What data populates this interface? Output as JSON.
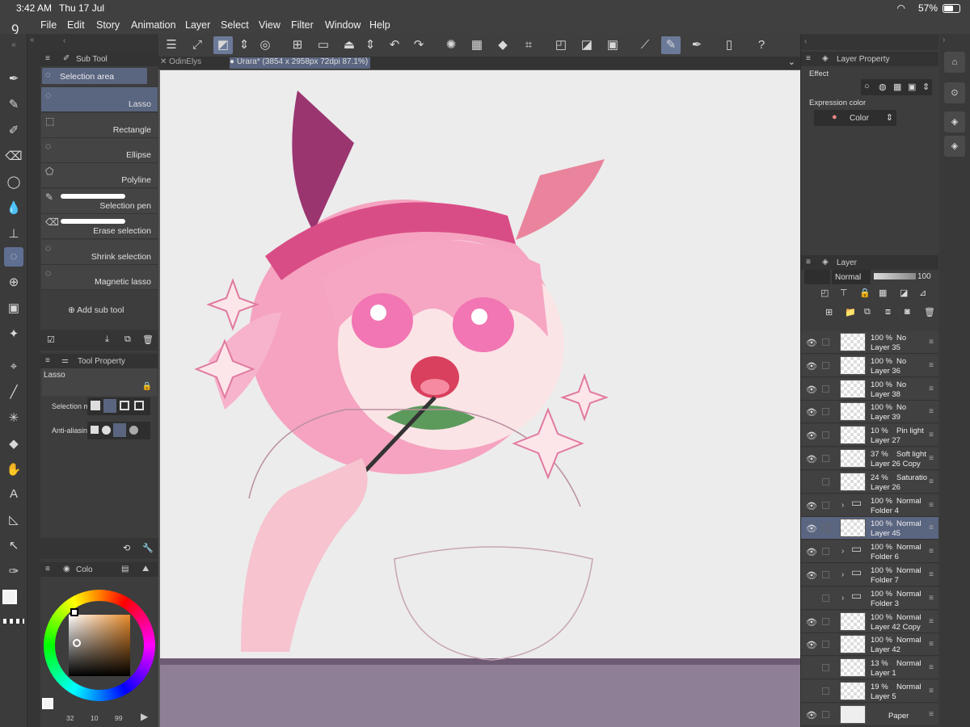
{
  "status": {
    "time": "3:42 AM",
    "date": "Thu 17 Jul",
    "battery": "57%",
    "battery_level": 0.57
  },
  "menu": [
    "File",
    "Edit",
    "Story",
    "Animation",
    "Layer",
    "Select",
    "View",
    "Filter",
    "Window",
    "Help"
  ],
  "canvas_tabs": {
    "tab1": "OdinElys",
    "tab2": "Urara* (3854 x 2958px 72dpi 87.1%)"
  },
  "subtool": {
    "header": "Sub Tool",
    "group": "Selection area",
    "items": [
      "Lasso",
      "Rectangle",
      "Ellipse",
      "Polyline",
      "Selection pen",
      "Erase selection",
      "Shrink selection",
      "Magnetic lasso"
    ],
    "add": "Add sub tool"
  },
  "toolprop": {
    "header": "Tool Property",
    "tool_name": "Lasso",
    "selection_mode": "Selection m",
    "anti_aliasing": "Anti-aliasing"
  },
  "color": {
    "header": "Colo",
    "stats": [
      "32",
      "10",
      "99"
    ],
    "main_color": "#f3f3f3",
    "sub_color": "#2b6a4c"
  },
  "layer_property": {
    "header": "Layer Property",
    "effect": "Effect",
    "expression_color": "Expression color",
    "color_value": "Color"
  },
  "layer_panel": {
    "header": "Layer",
    "blend_mode": "Normal",
    "opacity": "100",
    "layers": [
      {
        "op": "100 %",
        "mode": "No",
        "name": "Layer 35",
        "type": "layer",
        "visible": true
      },
      {
        "op": "100 %",
        "mode": "No",
        "name": "Layer 36",
        "type": "layer",
        "visible": true
      },
      {
        "op": "100 %",
        "mode": "No",
        "name": "Layer 38",
        "type": "layer",
        "visible": true
      },
      {
        "op": "100 %",
        "mode": "No",
        "name": "Layer 39",
        "type": "layer",
        "visible": true
      },
      {
        "op": "10 %",
        "mode": "Pin light",
        "name": "Layer 27",
        "type": "layer",
        "visible": true
      },
      {
        "op": "37 %",
        "mode": "Soft light",
        "name": "Layer 26 Copy",
        "type": "layer",
        "visible": true
      },
      {
        "op": "24 %",
        "mode": "Saturatio",
        "name": "Layer 26",
        "type": "layer",
        "visible": false
      },
      {
        "op": "100 %",
        "mode": "Normal",
        "name": "Folder 4",
        "type": "folder",
        "visible": true
      },
      {
        "op": "100 %",
        "mode": "Normal",
        "name": "Layer 45",
        "type": "layer",
        "visible": true,
        "selected": true
      },
      {
        "op": "100 %",
        "mode": "Normal",
        "name": "Folder 6",
        "type": "folder",
        "visible": true
      },
      {
        "op": "100 %",
        "mode": "Normal",
        "name": "Folder 7",
        "type": "folder",
        "visible": true
      },
      {
        "op": "100 %",
        "mode": "Normal",
        "name": "Folder 3",
        "type": "folder",
        "visible": false
      },
      {
        "op": "100 %",
        "mode": "Normal",
        "name": "Layer 42 Copy",
        "type": "layer",
        "visible": true
      },
      {
        "op": "100 %",
        "mode": "Normal",
        "name": "Layer 42",
        "type": "layer",
        "visible": true
      },
      {
        "op": "13 %",
        "mode": "Normal",
        "name": "Layer 1",
        "type": "layer",
        "visible": false
      },
      {
        "op": "19 %",
        "mode": "Normal",
        "name": "Layer 5",
        "type": "layer",
        "visible": false
      },
      {
        "op": "",
        "mode": "",
        "name": "Paper",
        "type": "paper",
        "visible": true
      }
    ]
  }
}
